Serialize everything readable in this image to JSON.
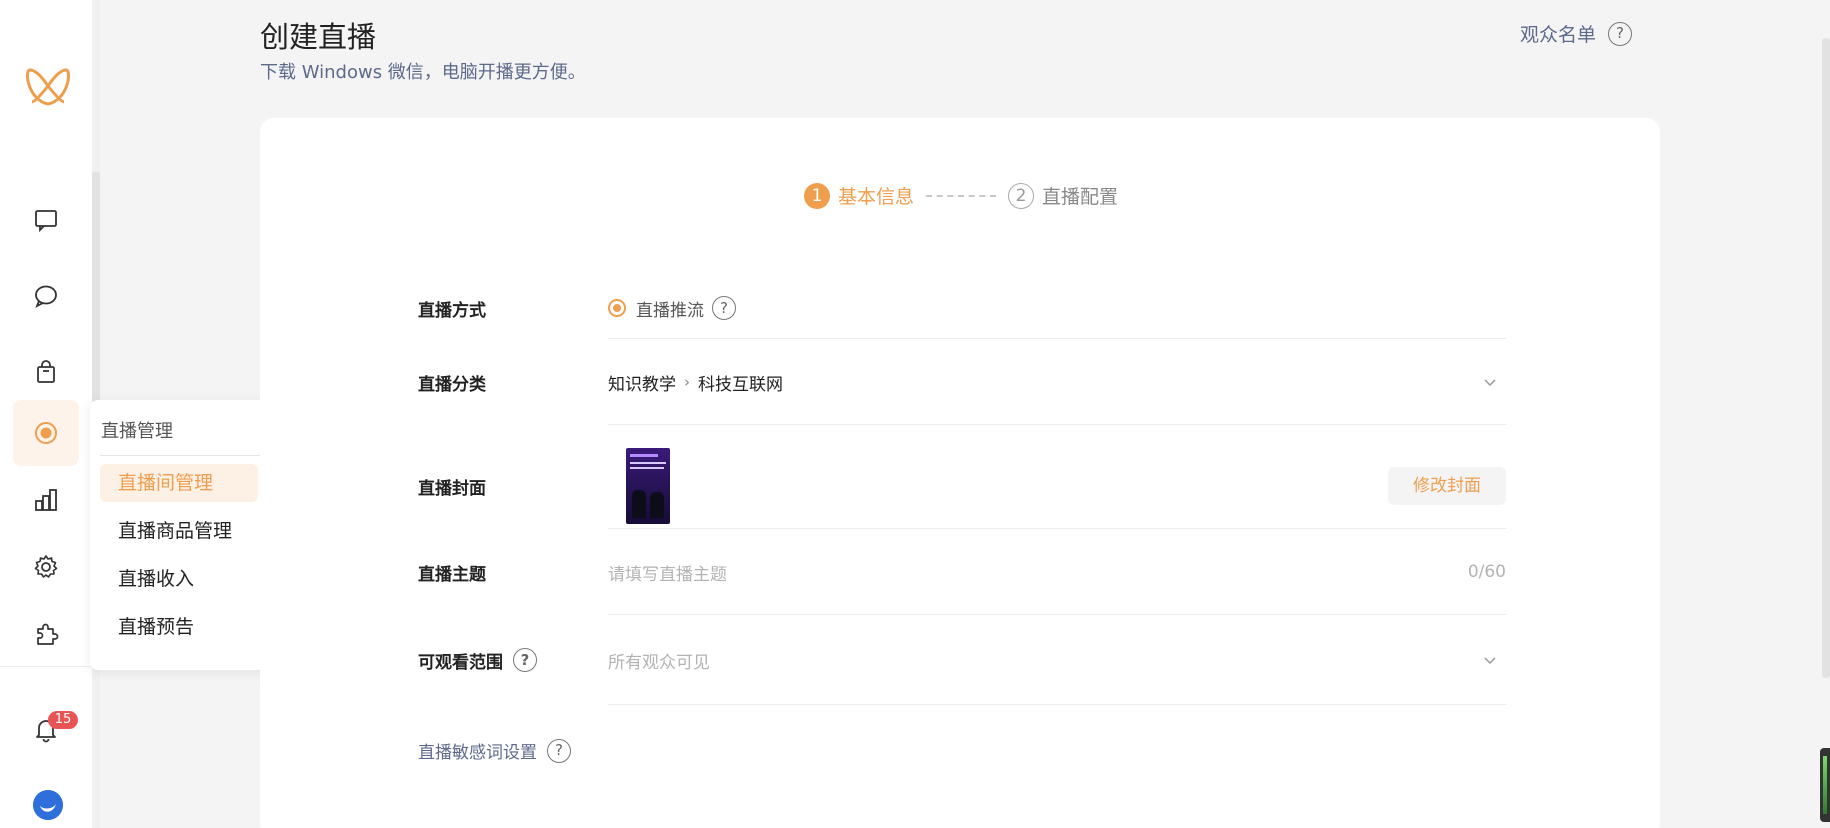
{
  "header": {
    "title": "创建直播",
    "subtitle": "下载 Windows 微信，电脑开播更方便。",
    "audience_list": "观众名单"
  },
  "sidebar": {
    "icons": [
      {
        "name": "message-square-icon",
        "active": false
      },
      {
        "name": "chat-bubble-icon",
        "active": false
      },
      {
        "name": "shopping-bag-icon",
        "active": false
      },
      {
        "name": "live-record-icon",
        "active": true
      },
      {
        "name": "bar-chart-icon",
        "active": false
      },
      {
        "name": "gear-icon",
        "active": false
      },
      {
        "name": "puzzle-icon",
        "active": false
      }
    ],
    "notification_count": "15"
  },
  "flyout": {
    "title": "直播管理",
    "items": [
      {
        "label": "直播间管理",
        "active": true
      },
      {
        "label": "直播商品管理",
        "active": false
      },
      {
        "label": "直播收入",
        "active": false
      },
      {
        "label": "直播预告",
        "active": false
      }
    ]
  },
  "steps": [
    {
      "num": "1",
      "label": "基本信息",
      "state": "done"
    },
    {
      "num": "2",
      "label": "直播配置",
      "state": "todo"
    }
  ],
  "form": {
    "mode": {
      "label": "直播方式",
      "value": "直播推流"
    },
    "category": {
      "label": "直播分类",
      "level1": "知识教学",
      "level2": "科技互联网"
    },
    "cover": {
      "label": "直播封面",
      "edit_button": "修改封面"
    },
    "topic": {
      "label": "直播主题",
      "placeholder": "请填写直播主题",
      "counter": "0/60"
    },
    "visibility": {
      "label": "可观看范围",
      "value": "所有观众可见"
    },
    "sensitive_words": "直播敏感词设置"
  },
  "colors": {
    "accent": "#ef9e4e",
    "link": "#5d6a8c",
    "badge": "#e95454"
  }
}
